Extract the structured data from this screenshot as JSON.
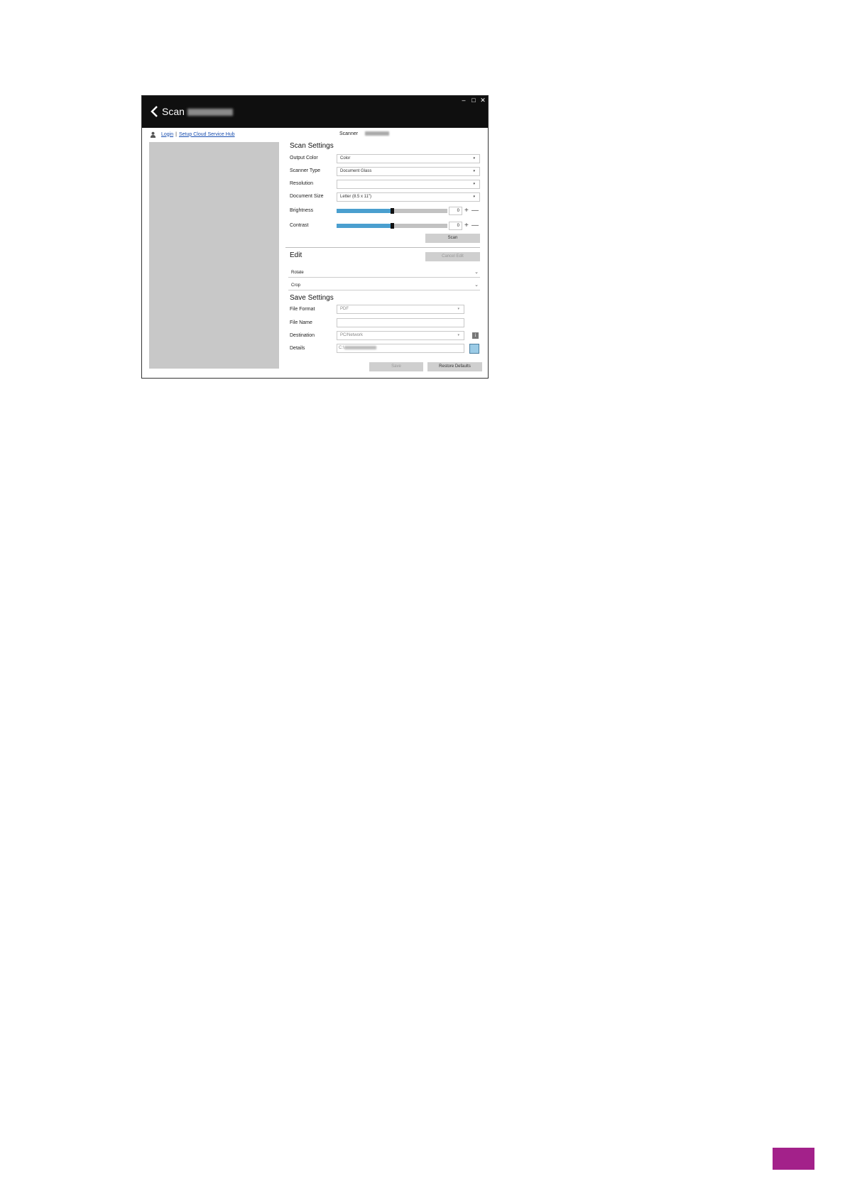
{
  "window": {
    "title": "Scan",
    "controls": {
      "minimize": "–",
      "maximize": "□",
      "close": "✕"
    }
  },
  "account": {
    "login_link": "Login",
    "separator": "|",
    "setup_link": "Setup Cloud Service Hub"
  },
  "scanner": {
    "label": "Scanner"
  },
  "scan_settings": {
    "title": "Scan Settings",
    "output_color": {
      "label": "Output Color",
      "value": "Color"
    },
    "scanner_type": {
      "label": "Scanner Type",
      "value": "Document Glass"
    },
    "resolution": {
      "label": "Resolution",
      "value": ""
    },
    "document_size": {
      "label": "Document Size",
      "value": "Letter (8.5 x 11\")"
    },
    "brightness": {
      "label": "Brightness",
      "value": "0",
      "level": 0.5
    },
    "contrast": {
      "label": "Contrast",
      "value": "0",
      "level": 0.5
    },
    "plus": "+",
    "minus": "—",
    "scan_button": "Scan"
  },
  "edit": {
    "title": "Edit",
    "cancel_button": "Cancel Edit",
    "rotate": "Rotate",
    "crop": "Crop"
  },
  "save_settings": {
    "title": "Save Settings",
    "file_format": {
      "label": "File Format",
      "value": "PDF"
    },
    "file_name": {
      "label": "File Name",
      "value": ""
    },
    "destination": {
      "label": "Destination",
      "value": "PC/Network"
    },
    "details": {
      "label": "Details",
      "value": "C:\\"
    },
    "info": "i",
    "save_button": "Save",
    "restore_button": "Restore Defaults"
  },
  "icons": {
    "back": "chevron-left-icon",
    "user": "user-icon",
    "dropdown": "▾",
    "chevron": "⌄"
  },
  "colors": {
    "titlebar": "#0f0f0f",
    "slider_fill": "#4a9fcf",
    "page_tab": "#a3218a"
  }
}
